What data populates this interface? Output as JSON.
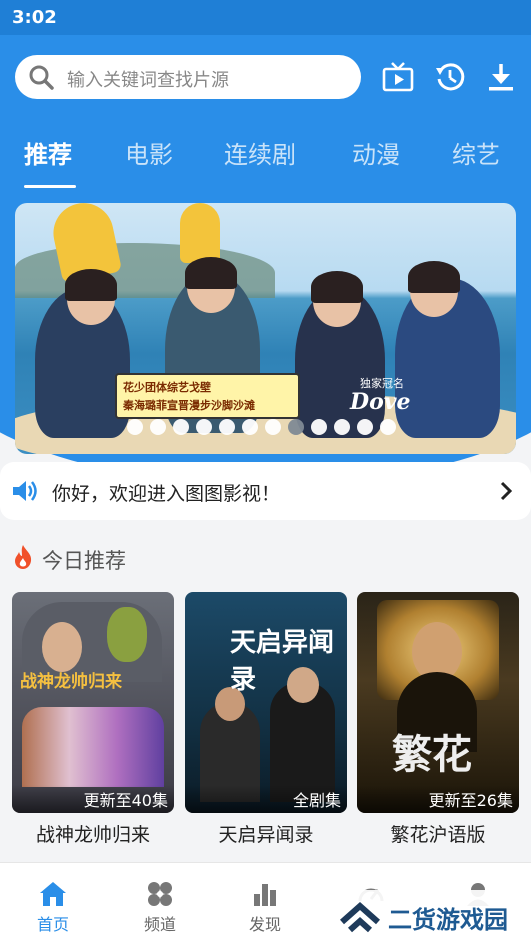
{
  "status_bar": {
    "time": "3:02"
  },
  "search": {
    "placeholder": "输入关键词查找片源"
  },
  "tabs": [
    {
      "label": "推荐",
      "active": true
    },
    {
      "label": "电影",
      "active": false
    },
    {
      "label": "连续剧",
      "active": false
    },
    {
      "label": "动漫",
      "active": false
    },
    {
      "label": "综艺",
      "active": false
    }
  ],
  "banner": {
    "promo_line1": "花少团体综艺戈壁",
    "promo_line2": "秦海璐菲宣晋漫步沙脚沙滩",
    "sponsor": "独家冠名",
    "brand": "Dove",
    "slide_count": 12,
    "active_slide": 8
  },
  "notice": {
    "text": "你好，欢迎进入图图影视！"
  },
  "section": {
    "title": "今日推荐"
  },
  "cards": [
    {
      "title": "战神龙帅归来",
      "badge": "更新至40集",
      "poster_text": "战神龙帅归来"
    },
    {
      "title": "天启异闻录",
      "badge": "全剧集",
      "poster_text": "天启异闻录"
    },
    {
      "title": "繁花沪语版",
      "badge": "更新至26集",
      "poster_text": "繁花"
    }
  ],
  "bottom_nav": [
    {
      "label": "首页",
      "active": true,
      "icon": "home-icon"
    },
    {
      "label": "频道",
      "active": false,
      "icon": "grid-icon"
    },
    {
      "label": "发现",
      "active": false,
      "icon": "bar-chart-icon"
    },
    {
      "label": "",
      "active": false,
      "icon": "gauge-icon"
    },
    {
      "label": "",
      "active": false,
      "icon": "user-icon"
    }
  ],
  "watermark": {
    "text": "二货游戏园"
  },
  "colors": {
    "primary": "#2a8ee8",
    "status_bar": "#1f7fd6",
    "background": "#f3f4f6"
  }
}
